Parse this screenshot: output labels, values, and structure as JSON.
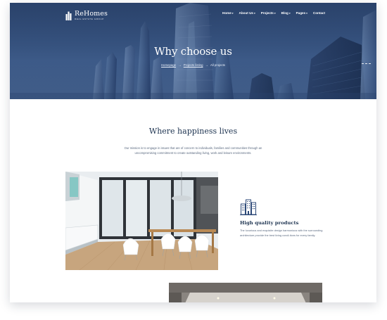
{
  "header": {
    "brand_name": "ReHomes",
    "brand_tagline": "REAL ESTATE GROUP",
    "nav": [
      {
        "label": "Home",
        "has_dropdown": true
      },
      {
        "label": "About Us",
        "has_dropdown": true
      },
      {
        "label": "Projects",
        "has_dropdown": true
      },
      {
        "label": "Blog",
        "has_dropdown": true
      },
      {
        "label": "Pages",
        "has_dropdown": true
      },
      {
        "label": "Contact",
        "has_dropdown": false
      }
    ],
    "dropdown_icon": "chevron-down-icon"
  },
  "hero": {
    "title": "Why choose us",
    "breadcrumb": [
      "Homepage",
      "Projects listing",
      "All projects"
    ],
    "breadcrumb_separator": "→",
    "background_subject": "city-skyscrapers"
  },
  "section": {
    "title": "Where happiness lives",
    "intro": "Our mission is to engage in issues that are of concern to individuals, families and communities through an uncompromising commitment to create outstanding living, work and leisure environments."
  },
  "feature": {
    "icon": "buildings-icon",
    "title": "High quality products",
    "description": "The luxurious and exquisite design harmonious with the surrounding architecture provide the best living condi-tions for every family."
  },
  "colors": {
    "accent_navy": "#1d3350",
    "hero_blue": "#3c5b8a",
    "body_text": "#5b6a80",
    "icon_blue": "#2e4a78"
  }
}
